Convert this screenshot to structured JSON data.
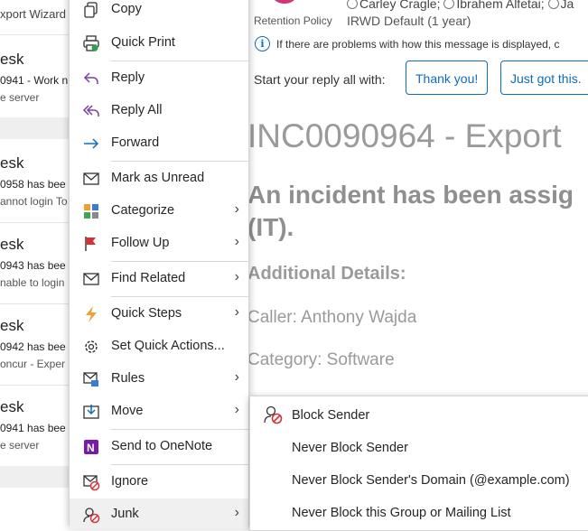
{
  "list": {
    "wizard_text": "xport Wizard",
    "items": [
      {
        "title": "esk",
        "line2": "0941 - Work n",
        "line3": "e server"
      },
      {
        "title": "esk",
        "line2": "0958 has bee",
        "line3": "annot login To"
      },
      {
        "title": "esk",
        "line2": "0943 has bee",
        "line3": "nable to login"
      },
      {
        "title": "esk",
        "line2": "0942 has bee",
        "line3": "oncur - Exper"
      },
      {
        "title": "esk",
        "line2": "0941 has bee",
        "line3": "e server"
      }
    ]
  },
  "header": {
    "recipients": [
      "Carley Cragle;",
      "Ibrahem Alfetai;",
      "Ja"
    ],
    "retention_label": "Retention Policy",
    "retention_value": "IRWD Default (1 year)",
    "info_text": "If there are problems with how this message is displayed, c"
  },
  "reply": {
    "label": "Start your reply all with:",
    "suggestions": [
      "Thank you!",
      "Just got this."
    ]
  },
  "message": {
    "subject": "INC0090964 - Export",
    "heading_line1": "An incident has been assig",
    "heading_line2": "(IT).",
    "details_heading": "Additional Details:",
    "caller": "Caller: Anthony Wajda",
    "category": "Category: Software"
  },
  "context_menu": [
    {
      "label": "Copy",
      "icon": "copy-icon",
      "submenu": false
    },
    {
      "label": "Quick Print",
      "icon": "printer-icon",
      "submenu": false
    },
    {
      "label": "Reply",
      "icon": "reply-icon",
      "submenu": false
    },
    {
      "label": "Reply All",
      "icon": "reply-all-icon",
      "submenu": false
    },
    {
      "label": "Forward",
      "icon": "forward-icon",
      "submenu": false
    },
    {
      "label": "Mark as Unread",
      "icon": "envelope-icon",
      "submenu": false
    },
    {
      "label": "Categorize",
      "icon": "categorize-icon",
      "submenu": true
    },
    {
      "label": "Follow Up",
      "icon": "flag-icon",
      "submenu": true
    },
    {
      "label": "Find Related",
      "icon": "find-related-icon",
      "submenu": true
    },
    {
      "label": "Quick Steps",
      "icon": "lightning-icon",
      "submenu": true
    },
    {
      "label": "Set Quick Actions...",
      "icon": "gear-icon",
      "submenu": false
    },
    {
      "label": "Rules",
      "icon": "rules-icon",
      "submenu": true
    },
    {
      "label": "Move",
      "icon": "move-icon",
      "submenu": true
    },
    {
      "label": "Send to OneNote",
      "icon": "onenote-icon",
      "submenu": false
    },
    {
      "label": "Ignore",
      "icon": "ignore-icon",
      "submenu": false
    },
    {
      "label": "Junk",
      "icon": "junk-icon",
      "submenu": true
    }
  ],
  "junk_submenu": [
    {
      "label": "Block Sender",
      "icon": "block-sender-icon"
    },
    {
      "label": "Never Block Sender",
      "icon": ""
    },
    {
      "label": "Never Block Sender's Domain (@example.com)",
      "icon": ""
    },
    {
      "label": "Never Block this Group or Mailing List",
      "icon": ""
    }
  ],
  "colors": {
    "accent": "#0f6cbd",
    "menu_highlight": "#f0f0f0",
    "body_text": "#9a9a9a"
  }
}
